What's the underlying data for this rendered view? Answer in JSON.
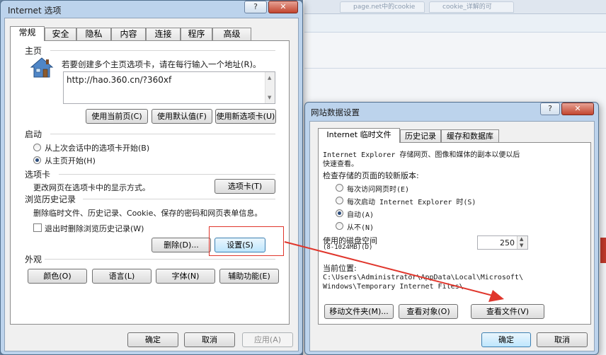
{
  "background": {
    "tab1": "page.net中的cookie",
    "tab2": "cookie_详解的可"
  },
  "inet": {
    "title": "Internet 选项",
    "help": "?",
    "close": "✕",
    "tabs": [
      "常规",
      "安全",
      "隐私",
      "内容",
      "连接",
      "程序",
      "高级"
    ],
    "homepage": {
      "group": "主页",
      "desc": "若要创建多个主页选项卡，请在每行输入一个地址(R)。",
      "url": "http://hao.360.cn/?360xf",
      "use_current": "使用当前页(C)",
      "use_default": "使用默认值(F)",
      "use_new_tab": "使用新选项卡(U)"
    },
    "startup": {
      "group": "启动",
      "opt1": "从上次会话中的选项卡开始(B)",
      "opt2": "从主页开始(H)"
    },
    "tabs_section": {
      "group": "选项卡",
      "desc": "更改网页在选项卡中的显示方式。",
      "button": "选项卡(T)"
    },
    "history": {
      "group": "浏览历史记录",
      "desc": "删除临时文件、历史记录、Cookie、保存的密码和网页表单信息。",
      "checkbox": "退出时删除浏览历史记录(W)",
      "delete": "删除(D)...",
      "settings": "设置(S)"
    },
    "appearance": {
      "group": "外观",
      "colors": "颜色(O)",
      "languages": "语言(L)",
      "fonts": "字体(N)",
      "accessibility": "辅助功能(E)"
    },
    "ok": "确定",
    "cancel": "取消",
    "apply": "应用(A)"
  },
  "site": {
    "title": "网站数据设置",
    "help": "?",
    "close": "✕",
    "tabs": [
      "Internet 临时文件",
      "历史记录",
      "缓存和数据库"
    ],
    "desc1": "Internet Explorer 存储网页、图像和媒体的副本以便以后",
    "desc2": "快速查看。",
    "check_label": "检查存储的页面的较新版本:",
    "opt1": "每次访问网页时(E)",
    "opt2": "每次启动 Internet Explorer 时(S)",
    "opt3": "自动(A)",
    "opt4": "从不(N)",
    "disk_label1": "使用的磁盘空间",
    "disk_label2": "(8-1024MB)(D)",
    "disk_value": "250",
    "loc_label": "当前位置:",
    "loc_line1": "C:\\Users\\Administrator\\AppData\\Local\\Microsoft\\",
    "loc_line2": "Windows\\Temporary Internet Files\\",
    "move": "移动文件夹(M)...",
    "view_objects": "查看对象(O)",
    "view_files": "查看文件(V)",
    "ok": "确定",
    "cancel": "取消"
  },
  "colors": {
    "annotation": "#e0362c",
    "accent": "#2a4b7c"
  }
}
